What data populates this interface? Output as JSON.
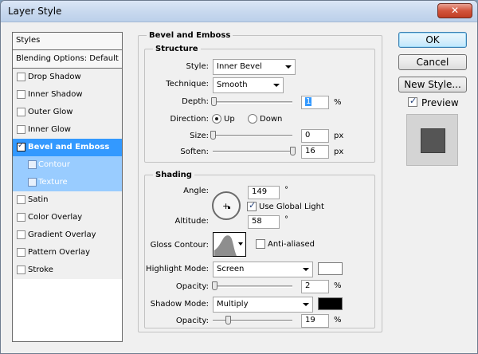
{
  "window": {
    "title": "Layer Style",
    "close_glyph": "✕"
  },
  "sidebar": {
    "header": "Styles",
    "blending": "Blending Options: Default",
    "items": [
      {
        "label": "Drop Shadow",
        "checked": false
      },
      {
        "label": "Inner Shadow",
        "checked": false
      },
      {
        "label": "Outer Glow",
        "checked": false
      },
      {
        "label": "Inner Glow",
        "checked": false
      },
      {
        "label": "Bevel and Emboss",
        "checked": true,
        "selected": true
      },
      {
        "label": "Contour",
        "checked": false,
        "sub": true
      },
      {
        "label": "Texture",
        "checked": false,
        "sub": true
      },
      {
        "label": "Satin",
        "checked": false
      },
      {
        "label": "Color Overlay",
        "checked": false
      },
      {
        "label": "Gradient Overlay",
        "checked": false
      },
      {
        "label": "Pattern Overlay",
        "checked": false
      },
      {
        "label": "Stroke",
        "checked": false
      }
    ]
  },
  "bevel": {
    "title": "Bevel and Emboss",
    "structure": {
      "title": "Structure",
      "style_label": "Style:",
      "style_value": "Inner Bevel",
      "technique_label": "Technique:",
      "technique_value": "Smooth",
      "depth_label": "Depth:",
      "depth_value": "1",
      "depth_unit": "%",
      "depth_slider": 0.01,
      "direction_label": "Direction:",
      "direction_up": "Up",
      "direction_down": "Down",
      "direction_selected": "Up",
      "size_label": "Size:",
      "size_value": "0",
      "size_unit": "px",
      "size_slider": 0.0,
      "soften_label": "Soften:",
      "soften_value": "16",
      "soften_unit": "px",
      "soften_slider": 1.0
    },
    "shading": {
      "title": "Shading",
      "angle_label": "Angle:",
      "angle_value": "149",
      "angle_unit": "°",
      "global_light_label": "Use Global Light",
      "global_light": true,
      "altitude_label": "Altitude:",
      "altitude_value": "58",
      "altitude_unit": "°",
      "gloss_label": "Gloss Contour:",
      "antialiased_label": "Anti-aliased",
      "antialiased": false,
      "highlight_mode_label": "Highlight Mode:",
      "highlight_mode_value": "Screen",
      "highlight_color": "#ffffff",
      "highlight_opacity_label": "Opacity:",
      "highlight_opacity_value": "2",
      "highlight_opacity_unit": "%",
      "highlight_opacity_slider": 0.02,
      "shadow_mode_label": "Shadow Mode:",
      "shadow_mode_value": "Multiply",
      "shadow_color": "#000000",
      "shadow_opacity_label": "Opacity:",
      "shadow_opacity_value": "19",
      "shadow_opacity_unit": "%",
      "shadow_opacity_slider": 0.19
    }
  },
  "actions": {
    "ok": "OK",
    "cancel": "Cancel",
    "new_style": "New Style...",
    "preview_label": "Preview",
    "preview_checked": true
  }
}
